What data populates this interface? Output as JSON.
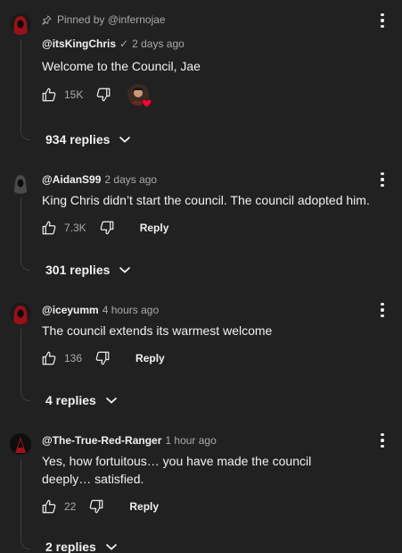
{
  "pinned_by": "Pinned by @infernojae",
  "comments": [
    {
      "author": "@itsKingChris",
      "verified": "✓",
      "time": "2 days ago",
      "text": "Welcome to the Council, Jae",
      "likes": "15K",
      "replies": "934 replies"
    },
    {
      "author": "@AidanS99",
      "time": "2 days ago",
      "text": "King Chris didn’t start the council. The council adopted him.",
      "likes": "7.3K",
      "reply_label": "Reply",
      "replies": "301 replies"
    },
    {
      "author": "@iceyumm",
      "time": "4 hours ago",
      "text": "The council extends its warmest welcome",
      "likes": "136",
      "reply_label": "Reply",
      "replies": "4 replies"
    },
    {
      "author": "@The-True-Red-Ranger",
      "time": "1 hour ago",
      "text": "Yes, how fortuitous… you have made the council deeply… satisfied.",
      "likes": "22",
      "reply_label": "Reply",
      "replies": "2 replies"
    }
  ],
  "colors": {
    "background": "#212121",
    "text": "#f1f1f1",
    "secondary_text": "#aaaaaa",
    "heart": "#ff0033",
    "avatar_red": "#8b0f16"
  },
  "icons": {
    "pin": "pin-icon",
    "like": "thumbs-up-icon",
    "dislike": "thumbs-down-icon",
    "more": "more-vertical-icon",
    "expand": "chevron-down-icon",
    "creator_heart": "heart-icon"
  }
}
